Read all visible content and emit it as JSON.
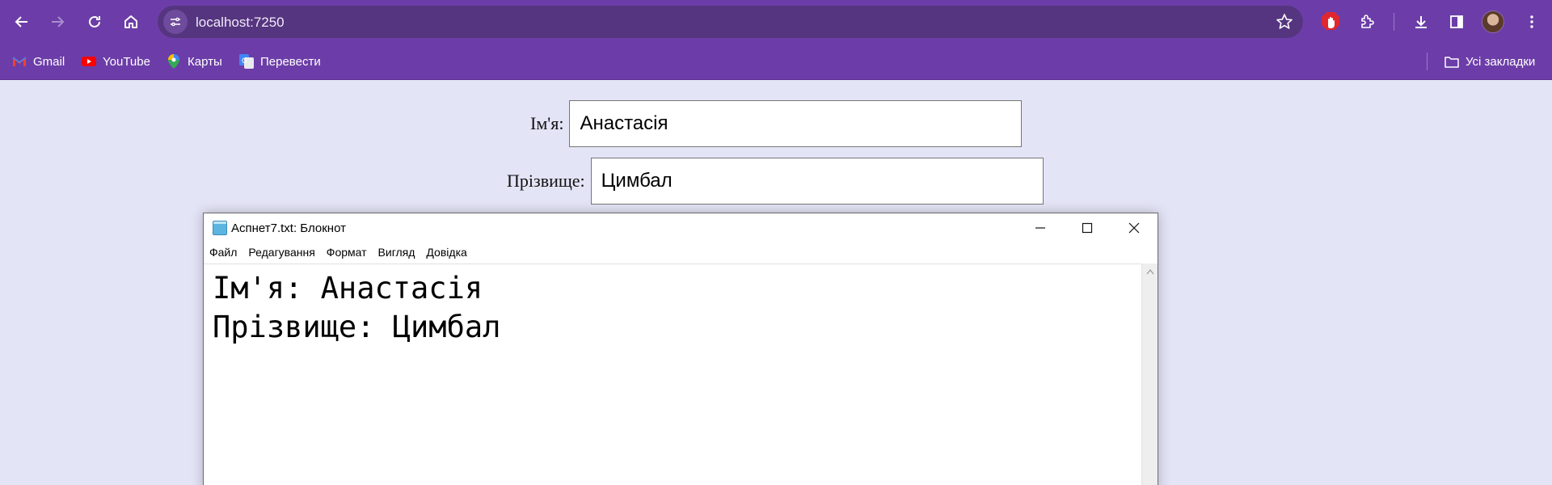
{
  "browser": {
    "url": "localhost:7250",
    "bookmarks": [
      {
        "label": "Gmail",
        "icon": "gmail-icon"
      },
      {
        "label": "YouTube",
        "icon": "youtube-icon"
      },
      {
        "label": "Карты",
        "icon": "maps-icon"
      },
      {
        "label": "Перевести",
        "icon": "translate-icon"
      }
    ],
    "all_bookmarks_label": "Усі закладки",
    "accent_color": "#6c3da8"
  },
  "form": {
    "first_name_label": "Ім'я:",
    "first_name_value": "Анастасія",
    "last_name_label": "Прізвище:",
    "last_name_value": "Цимбал"
  },
  "notepad": {
    "title": "Аспнет7.txt: Блокнот",
    "menu": [
      "Файл",
      "Редагування",
      "Формат",
      "Вигляд",
      "Довідка"
    ],
    "lines": [
      "Ім'я: Анастасія",
      "Прізвище: Цимбал"
    ]
  }
}
